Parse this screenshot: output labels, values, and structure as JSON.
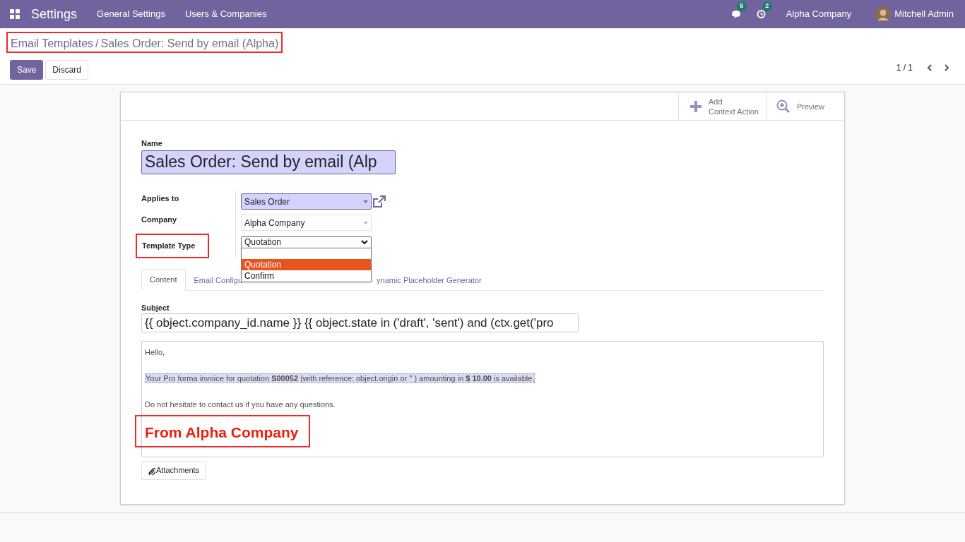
{
  "navbar": {
    "app": "Settings",
    "menus": [
      "General Settings",
      "Users & Companies"
    ],
    "messages_count": "5",
    "activities_count": "2",
    "company": "Alpha Company",
    "user": "Mitchell Admin"
  },
  "breadcrumb": {
    "parent": "Email Templates",
    "separator": "/",
    "current": "Sales Order: Send by email (Alpha)"
  },
  "buttons": {
    "save": "Save",
    "discard": "Discard"
  },
  "pager": "1 / 1",
  "sheet_actions": [
    {
      "kind": "add",
      "label": "Add\nContext Action"
    },
    {
      "kind": "preview",
      "label": "Preview"
    }
  ],
  "name": {
    "label": "Name",
    "value": "Sales Order: Send by email (Alp"
  },
  "applies_to": {
    "label": "Applies to",
    "value": "Sales Order"
  },
  "company": {
    "label": "Company",
    "value": "Alpha Company"
  },
  "template_type": {
    "label": "Template Type",
    "value": "Quotation",
    "options": [
      {
        "label": "Quotation",
        "selected": true
      },
      {
        "label": "Confirm",
        "selected": false
      }
    ]
  },
  "tabs": [
    {
      "label": "Content",
      "selected": true
    },
    {
      "label": "Email Configu",
      "selected": false
    },
    {
      "label": "ynamic Placeholder Generator",
      "selected": false
    }
  ],
  "subject": {
    "label": "Subject",
    "value": "{{ object.company_id.name }} {{ object.state in ('draft', 'sent') and (ctx.get('pro"
  },
  "body": {
    "greeting": "Hello,",
    "message": "Your Pro forma invoice for quotation **S00052** (with reference: object.origin or '' ) amounting in **$ 10.00** is available.",
    "closing": "Do not hesitate to contact us if you have any questions.",
    "signature": "From Alpha Company"
  },
  "attachments_button": "Attachments"
}
